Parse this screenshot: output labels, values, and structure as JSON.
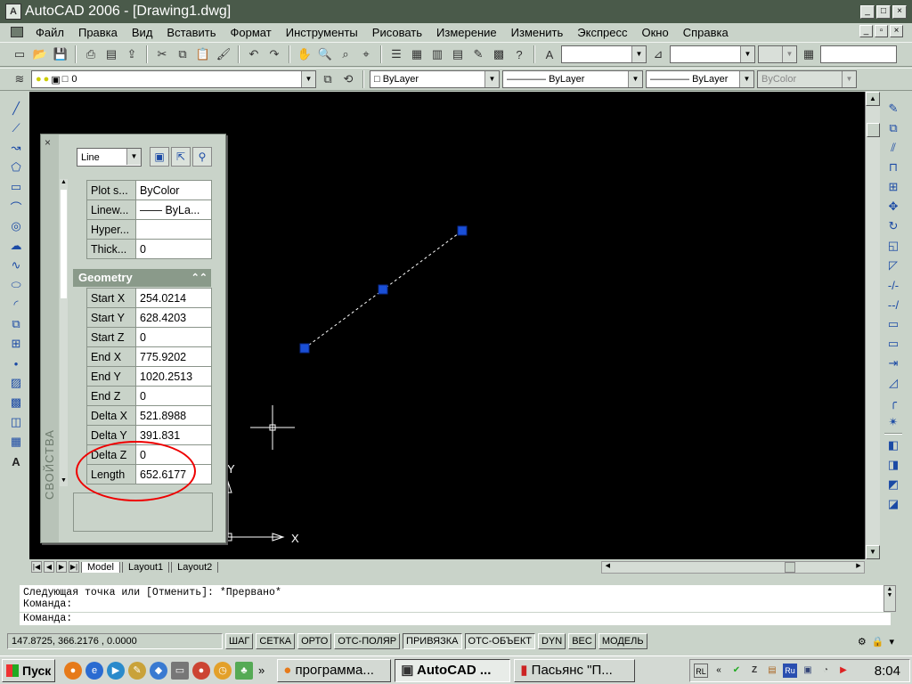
{
  "window": {
    "title": "AutoCAD 2006 - [Drawing1.dwg]",
    "app_icon_label": "A",
    "controls": [
      "_",
      "□",
      "×"
    ]
  },
  "menu": {
    "items": [
      "Файл",
      "Правка",
      "Вид",
      "Вставить",
      "Формат",
      "Инструменты",
      "Рисовать",
      "Измерение",
      "Изменить",
      "Экспресс",
      "Окно",
      "Справка"
    ],
    "doc_controls": [
      "_",
      "▫",
      "×"
    ]
  },
  "toolbar_layers": {
    "layer_value": "0",
    "color_value": "ByLayer",
    "linetype_value": "ByLayer",
    "lineweight_value": "ByLayer",
    "plotstyle_value": "ByColor"
  },
  "properties": {
    "panel_title": "СВОЙСТВА",
    "object_type": "Line",
    "general_rows": [
      {
        "key": "Plot s...",
        "value": "ByColor"
      },
      {
        "key": "Linew...",
        "value": "—— ByLa..."
      },
      {
        "key": "Hyper...",
        "value": ""
      },
      {
        "key": "Thick...",
        "value": "0"
      }
    ],
    "geometry_header": "Geometry",
    "geometry_rows": [
      {
        "key": "Start X",
        "value": "254.0214"
      },
      {
        "key": "Start Y",
        "value": "628.4203"
      },
      {
        "key": "Start Z",
        "value": "0"
      },
      {
        "key": "End X",
        "value": "775.9202"
      },
      {
        "key": "End Y",
        "value": "1020.2513"
      },
      {
        "key": "End Z",
        "value": "0"
      },
      {
        "key": "Delta X",
        "value": "521.8988"
      },
      {
        "key": "Delta Y",
        "value": "391.831"
      },
      {
        "key": "Delta Z",
        "value": "0"
      },
      {
        "key": "Length",
        "value": "652.6177"
      }
    ]
  },
  "canvas": {
    "ucs_x_label": "X",
    "ucs_y_label": "Y"
  },
  "tabs": [
    "Model",
    "Layout1",
    "Layout2"
  ],
  "command": {
    "history_line1": "Следующая точка или [Отменить]: *Прервано*",
    "history_line2": "Команда:",
    "prompt": "Команда:"
  },
  "statusbar": {
    "coordinates": "147.8725, 366.2176 , 0.0000",
    "buttons": [
      {
        "label": "ШАГ",
        "on": false
      },
      {
        "label": "СЕТКА",
        "on": false
      },
      {
        "label": "ОРТО",
        "on": false
      },
      {
        "label": "ОТС-ПОЛЯР",
        "on": false
      },
      {
        "label": "ПРИВЯЗКА",
        "on": true
      },
      {
        "label": "ОТС-ОБЪЕКТ",
        "on": true
      },
      {
        "label": "DYN",
        "on": false
      },
      {
        "label": "ВЕС",
        "on": false
      },
      {
        "label": "МОДЕЛЬ",
        "on": false
      }
    ]
  },
  "taskbar": {
    "start_label": "Пуск",
    "more_label": "»",
    "tasks": [
      {
        "label": "программа...",
        "active": false
      },
      {
        "label": "AutoCAD ...",
        "active": true
      },
      {
        "label": "Пасьянс \"П...",
        "active": false
      }
    ],
    "tray_lang": "RL",
    "tray_ru": "Ru",
    "clock": "8:04"
  }
}
